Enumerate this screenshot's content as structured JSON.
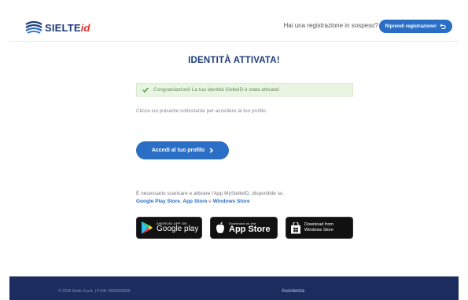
{
  "header": {
    "logo_text": "SIELTE",
    "logo_suffix": "id",
    "pending_text": "Hai una registrazione in sospeso?",
    "resume_label": "Riprendi registrazione!"
  },
  "main": {
    "title": "IDENTITÀ ATTIVATA!",
    "alert_text": "Congratulazioni! La tua identità SielteID è stata attivata!",
    "instruction": "Clicca sul pulsante sottostante per accedere al tuo profilo.",
    "profile_button": "Accedi al tuo profilo",
    "app_info_text": "È necessario scaricare e attivare l'App MySielteID, disponibile su",
    "app_links": {
      "google": "Google Play Store",
      "comma": ",",
      "apple": "App Store",
      "conj": "e",
      "windows": "Windows Store"
    }
  },
  "stores": {
    "google_small": "ANDROID APP ON",
    "google_big": "Google play",
    "apple_small": "Download on the",
    "apple_big": "App Store",
    "windows_line1": "Download from",
    "windows_line2": "Windows Store"
  },
  "footer": {
    "left_text": "© 2018 Sielte S.p.A. | P.IVA: 00000/000/0",
    "right_text": "Assistenza"
  },
  "colors": {
    "brand_blue": "#1e3d7b",
    "accent_blue": "#2a6ec6",
    "success_bg": "#e9f5e3",
    "footer_bg": "#1c2c5e",
    "logo_red": "#e3352b"
  }
}
